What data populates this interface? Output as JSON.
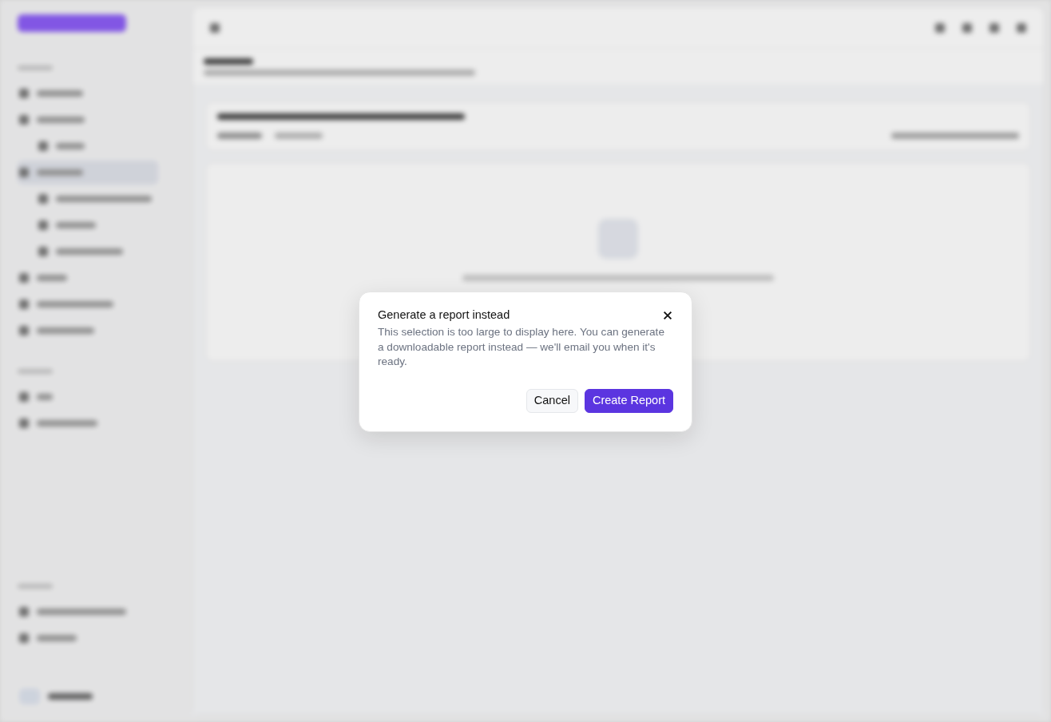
{
  "modal": {
    "title": "Generate a report instead",
    "body": "This selection is too large to display here. You can generate a downloadable report instead — we'll email you when it's ready.",
    "buttons": [
      {
        "label": "Cancel",
        "kind": "secondary"
      },
      {
        "label": "Create Report",
        "kind": "primary"
      }
    ]
  }
}
